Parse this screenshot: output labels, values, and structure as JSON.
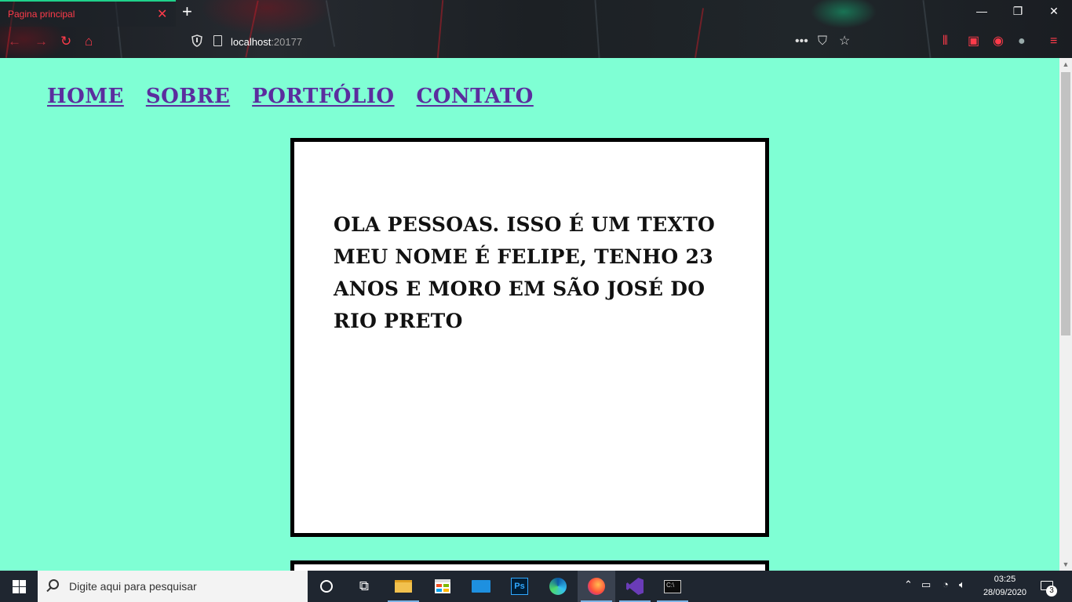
{
  "browser": {
    "tab_title": "Pagina principal",
    "tab_close": "✕",
    "new_tab": "+",
    "url_host": "localhost",
    "url_port": ":20177",
    "window_controls": {
      "minimize": "—",
      "restore": "❐",
      "close": "✕"
    },
    "nav_icons": [
      "back-icon",
      "forward-icon",
      "reload-icon",
      "home-icon"
    ],
    "toolbar_icons": [
      "page-actions-icon",
      "pocket-icon",
      "bookmark-star-icon",
      "library-icon",
      "sidebar-icon",
      "account-icon",
      "extension-icon",
      "menu-icon"
    ],
    "accent_color": "#ff3b4a",
    "tab_indicator_color": "#1fd18b"
  },
  "page": {
    "background": "#7fffd4",
    "nav": [
      {
        "label": "Home"
      },
      {
        "label": "Sobre"
      },
      {
        "label": "Portfólio"
      },
      {
        "label": "Contato"
      }
    ],
    "nav_color": "#5b2d9e",
    "card_text": "Ola pessoas. Isso é um texto meu nome é Felipe, tenho 23 anos e moro em São José do Rio Preto"
  },
  "taskbar": {
    "search_placeholder": "Digite aqui para pesquisar",
    "time": "03:25",
    "date": "28/09/2020",
    "notification_count": "3",
    "apps": [
      "cortana-icon",
      "task-view-icon",
      "file-explorer-icon",
      "store-icon",
      "mail-icon",
      "photoshop-icon",
      "edge-icon",
      "firefox-icon",
      "visual-studio-icon",
      "terminal-icon"
    ]
  }
}
